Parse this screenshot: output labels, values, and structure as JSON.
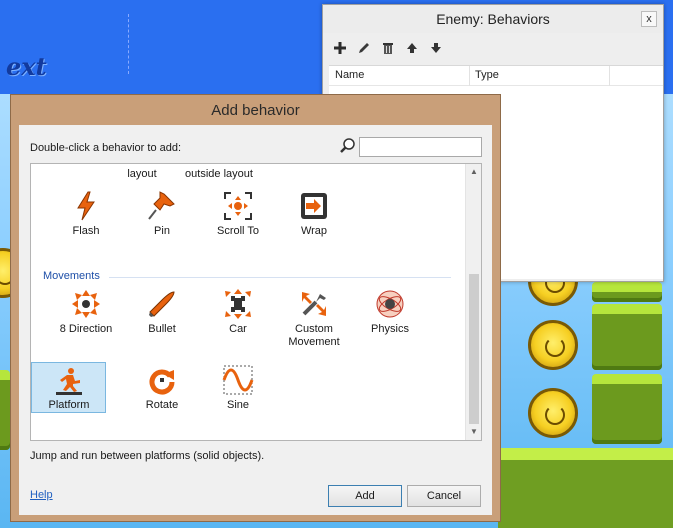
{
  "scene": {
    "title_fragment": "ext"
  },
  "behaviors_panel": {
    "title": "Enemy: Behaviors",
    "close_glyph": "x",
    "toolbar": [
      "add-icon",
      "edit-icon",
      "delete-icon",
      "move-up-icon",
      "move-down-icon"
    ],
    "columns": {
      "name": "Name",
      "type": "Type"
    }
  },
  "dialog": {
    "title": "Add behavior",
    "instruction": "Double-click a behavior to add:",
    "search": {
      "value": "",
      "placeholder": ""
    },
    "top_partial_labels": [
      "layout",
      "outside layout"
    ],
    "general_row": [
      {
        "label": "Flash",
        "icon": "flash-icon"
      },
      {
        "label": "Pin",
        "icon": "pin-icon"
      },
      {
        "label": "Scroll To",
        "icon": "scroll-to-icon"
      },
      {
        "label": "Wrap",
        "icon": "wrap-icon"
      }
    ],
    "movements_header": "Movements",
    "movements": [
      {
        "label": "8 Direction",
        "icon": "eight-direction-icon"
      },
      {
        "label": "Bullet",
        "icon": "bullet-icon"
      },
      {
        "label": "Car",
        "icon": "car-icon"
      },
      {
        "label": "Custom Movement",
        "icon": "custom-movement-icon"
      },
      {
        "label": "Physics",
        "icon": "physics-icon"
      },
      {
        "label": "Platform",
        "icon": "platform-icon",
        "selected": true
      },
      {
        "label": "Rotate",
        "icon": "rotate-icon"
      },
      {
        "label": "Sine",
        "icon": "sine-icon"
      }
    ],
    "description": "Jump and run between platforms (solid objects).",
    "help_label": "Help",
    "add_label": "Add",
    "cancel_label": "Cancel",
    "scroll": {
      "up_glyph": "▲",
      "down_glyph": "▼"
    }
  },
  "colors": {
    "dialog_frame": "#c99f79",
    "section_header": "#1e4fa8",
    "selection": "#cce6f7",
    "icon_orange": "#e8620e"
  }
}
